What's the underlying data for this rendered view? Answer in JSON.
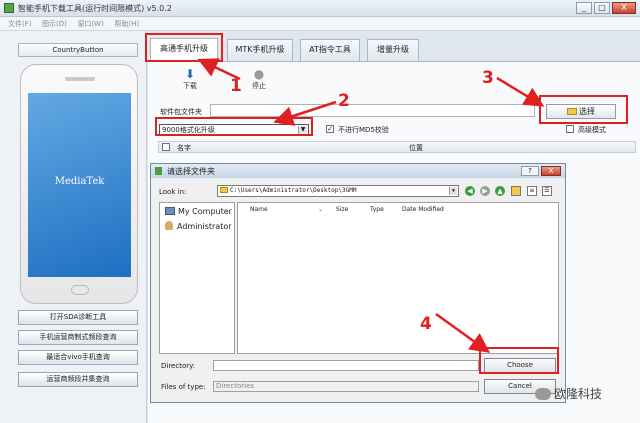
{
  "window": {
    "title": "智能手机下载工具(运行时间限模式) v5.0.2",
    "controls": [
      "_",
      "□",
      "X"
    ]
  },
  "menu": [
    "文件(F)",
    "图示(D)",
    "窗口(W)",
    "帮助(H)"
  ],
  "left": {
    "country_button": "CountryButton",
    "phone_screen_text": "MediaTek",
    "buttons": [
      "打开SDA诊断工具",
      "手机运营商制式频段查询",
      "最适合vivo手机查询",
      "运营商频段并集查询"
    ]
  },
  "tabs": [
    "高通手机升级",
    "MTK手机升级",
    "AT指令工具",
    "增量升级"
  ],
  "toolbar": {
    "download": "下载",
    "stop": "停止"
  },
  "package": {
    "label": "软件包文件夹",
    "select_button": "选择"
  },
  "mode": {
    "selected": "9000格式化升级"
  },
  "options": {
    "no_md5": "不进行MD5校验",
    "advanced": "高级模式"
  },
  "list_header": {
    "name": "名字",
    "location": "位置"
  },
  "dialog": {
    "title": "请选择文件夹",
    "lookin_label": "Look in:",
    "lookin_path": "C:\\Users\\Administrator\\Desktop\\3GMM",
    "sidebar": [
      "My Computer",
      "Administrator"
    ],
    "columns": [
      "Name",
      "Size",
      "Type",
      "Date Modified"
    ],
    "directory_label": "Directory:",
    "directory_value": "",
    "files_of_type_label": "Files of type:",
    "files_of_type_value": "Directories",
    "choose_button": "Choose",
    "cancel_button": "Cancel",
    "help_button": "?",
    "close_button": "X"
  },
  "annotations": [
    "1",
    "2",
    "3",
    "4"
  ],
  "watermark": "欧隆科技",
  "colors": {
    "annotation": "#e02020",
    "phone_screen": "#1e6fc2",
    "folder": "#f2c94c"
  }
}
